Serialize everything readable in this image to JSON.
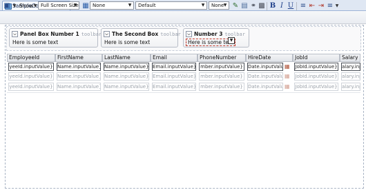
{
  "file_tab": {
    "label": "SampleControls.jspx"
  },
  "toolbar": {
    "show_label": "Show",
    "screen_size": "Full Screen Size",
    "style_class": "None",
    "skin": "Default",
    "font": "None",
    "bold": "B",
    "italic": "I",
    "underline": "U"
  },
  "panel_boxes": [
    {
      "title": "Panel Box Number 1",
      "toolbar_label": "toolbar",
      "text": "Here is some text"
    },
    {
      "title": "The Second Box",
      "toolbar_label": "toolbar",
      "text": "Here is some text"
    },
    {
      "title": "Number 3",
      "toolbar_label": "toolbar",
      "text": "Here is some text"
    }
  ],
  "table": {
    "columns": [
      "EmployeeId",
      "FirstName",
      "LastName",
      "Email",
      "PhoneNumber",
      "HireDate",
      "JobId",
      "Salary"
    ],
    "rows": [
      [
        "yeeId.inputValue}",
        "Name.inputValue}",
        "Name.inputValue}",
        "Email.inputValue}",
        "mber.inputValue}",
        "Date.inputValue}",
        "JobId.inputValue}",
        "alary.inpu"
      ],
      [
        "yeeId.inputValue}",
        "Name.inputValue}",
        "Name.inputValue}",
        "Email.inputValue}",
        "mber.inputValue}",
        "Date.inputValue}",
        "JobId.inputValue}",
        "alary.inpu"
      ],
      [
        "yeeId.inputValue}",
        "Name.inputValue}",
        "Name.inputValue}",
        "Email.inputValue}",
        "mber.inputValue}",
        "Date.inputValue}",
        "JobId.inputValue}",
        "alary.inpu"
      ]
    ]
  },
  "icons": {
    "file": "jspx-file-icon",
    "show": "show-menu-icon",
    "calendar": "calendar-icon"
  }
}
